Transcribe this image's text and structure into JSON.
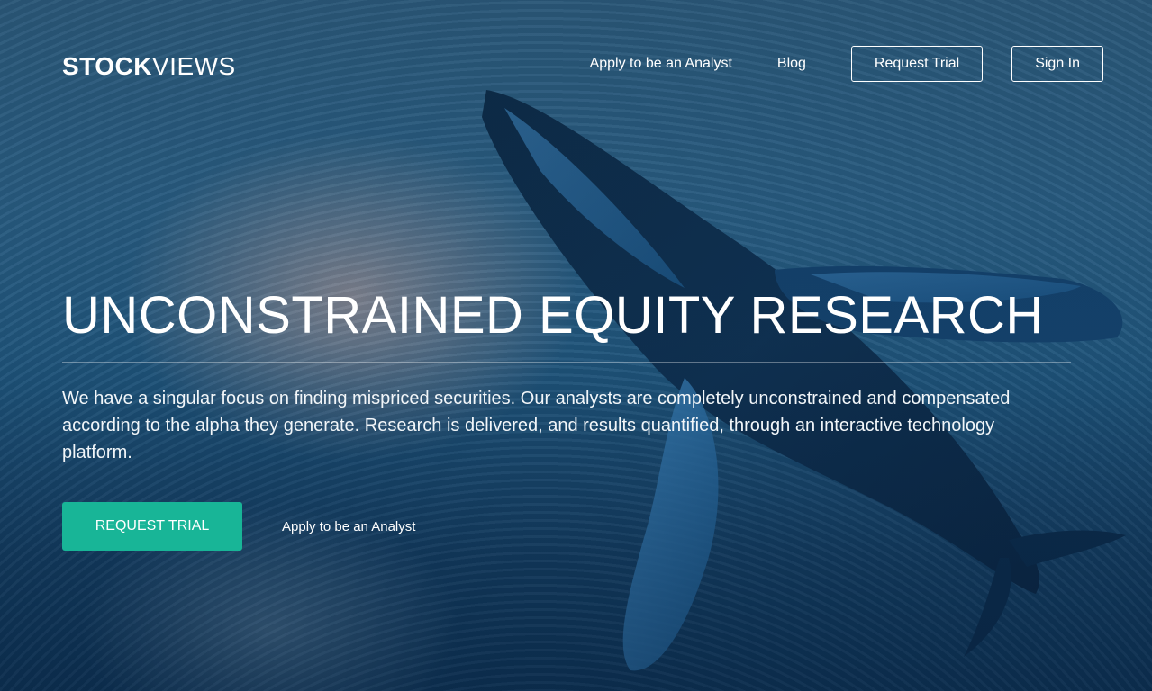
{
  "header": {
    "logo_bold": "STOCK",
    "logo_light": "VIEWS",
    "nav": {
      "apply_label": "Apply to be an Analyst",
      "blog_label": "Blog",
      "request_trial_label": "Request Trial",
      "sign_in_label": "Sign In"
    }
  },
  "hero": {
    "headline": "UNCONSTRAINED EQUITY RESEARCH",
    "description": "We have a singular focus on finding mispriced securities. Our analysts are completely unconstrained and compensated according to the alpha they generate. Research is delivered, and results quantified, through an interactive technology platform.",
    "cta_label": "REQUEST TRIAL",
    "secondary_link_label": "Apply to be an Analyst"
  },
  "colors": {
    "accent": "#18b597",
    "ocean_dark": "#0f3557",
    "ocean_mid": "#2a5f84"
  }
}
